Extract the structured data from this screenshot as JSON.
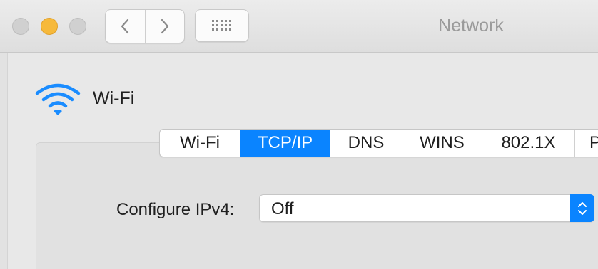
{
  "window": {
    "title": "Network",
    "controls": [
      "close",
      "minimize",
      "zoom"
    ]
  },
  "toolbar": {
    "back_icon": "chevron-left-icon",
    "forward_icon": "chevron-right-icon",
    "show_all_icon": "grid-icon"
  },
  "interface": {
    "icon": "wifi-icon",
    "name": "Wi-Fi"
  },
  "tabs": [
    {
      "label": "Wi-Fi",
      "active": false
    },
    {
      "label": "TCP/IP",
      "active": true
    },
    {
      "label": "DNS",
      "active": false
    },
    {
      "label": "WINS",
      "active": false
    },
    {
      "label": "802.1X",
      "active": false
    },
    {
      "label": "P",
      "active": false
    }
  ],
  "configure": {
    "label": "Configure IPv4:",
    "value": "Off"
  },
  "colors": {
    "accent": "#0a84ff",
    "minimize": "#f6b93b"
  }
}
